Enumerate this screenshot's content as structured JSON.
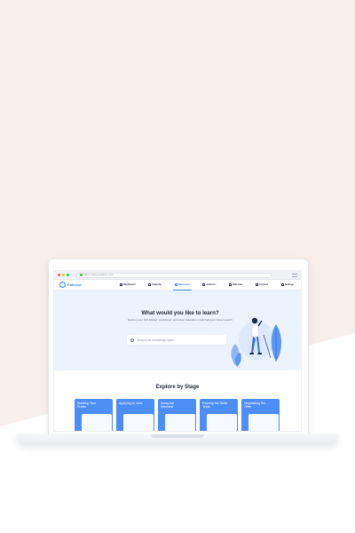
{
  "browser": {
    "url": "https://beta.pathrise.com",
    "dot_colors": [
      "#ff5f56",
      "#ffbd2e",
      "#27c93f"
    ]
  },
  "app": {
    "brand": "Pathrise",
    "accent": "#3b82f6",
    "nav": [
      {
        "label": "Dashboard",
        "icon": "dashboard-icon",
        "active": false
      },
      {
        "label": "Calendar",
        "icon": "calendar-icon",
        "active": false
      },
      {
        "label": "Resources",
        "icon": "resources-icon",
        "active": true
      },
      {
        "label": "Advisors",
        "icon": "advisors-icon",
        "active": false
      },
      {
        "label": "Referrals",
        "icon": "referrals-icon",
        "active": false
      },
      {
        "label": "Connect",
        "icon": "connect-icon",
        "active": false
      },
      {
        "label": "Settings",
        "icon": "settings-icon",
        "active": false
      }
    ]
  },
  "hero": {
    "title": "What would you like to learn?",
    "subtitle": "Explore over 100 articles, workshops, and other materials to help fuel your career search",
    "search_placeholder": "Search the knowledge base..."
  },
  "explore": {
    "title": "Explore by Stage",
    "cards": [
      {
        "label": "Building Your Profile"
      },
      {
        "label": "Applying to Jobs"
      },
      {
        "label": "Acing the Interview"
      },
      {
        "label": "Passing the Skills Tests"
      },
      {
        "label": "Negotiating the Offer"
      }
    ],
    "card_color": "#4c8df6"
  }
}
